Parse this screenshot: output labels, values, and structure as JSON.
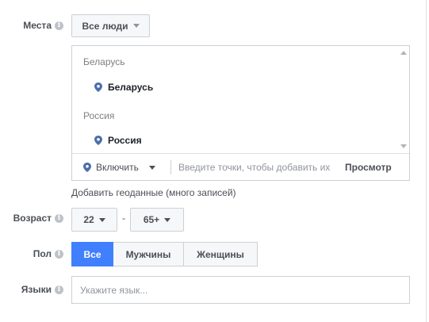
{
  "locations": {
    "label": "Места",
    "audience_dropdown": "Все люди",
    "groups": [
      {
        "title": "Беларусь",
        "item": "Беларусь"
      },
      {
        "title": "Россия",
        "item": "Россия"
      }
    ],
    "include_label": "Включить",
    "search_placeholder": "Введите точки, чтобы добавить их",
    "browse_label": "Просмотр",
    "geo_link": "Добавить геоданные (много записей)"
  },
  "age": {
    "label": "Возраст",
    "min": "22",
    "separator": "-",
    "max": "65+"
  },
  "gender": {
    "label": "Пол",
    "options": [
      "Все",
      "Мужчины",
      "Женщины"
    ],
    "selected": "Все"
  },
  "languages": {
    "label": "Языки",
    "placeholder": "Укажите язык..."
  },
  "colors": {
    "accent": "#4080ff",
    "pin": "#4b6ea9",
    "border": "#ccd0d5"
  }
}
